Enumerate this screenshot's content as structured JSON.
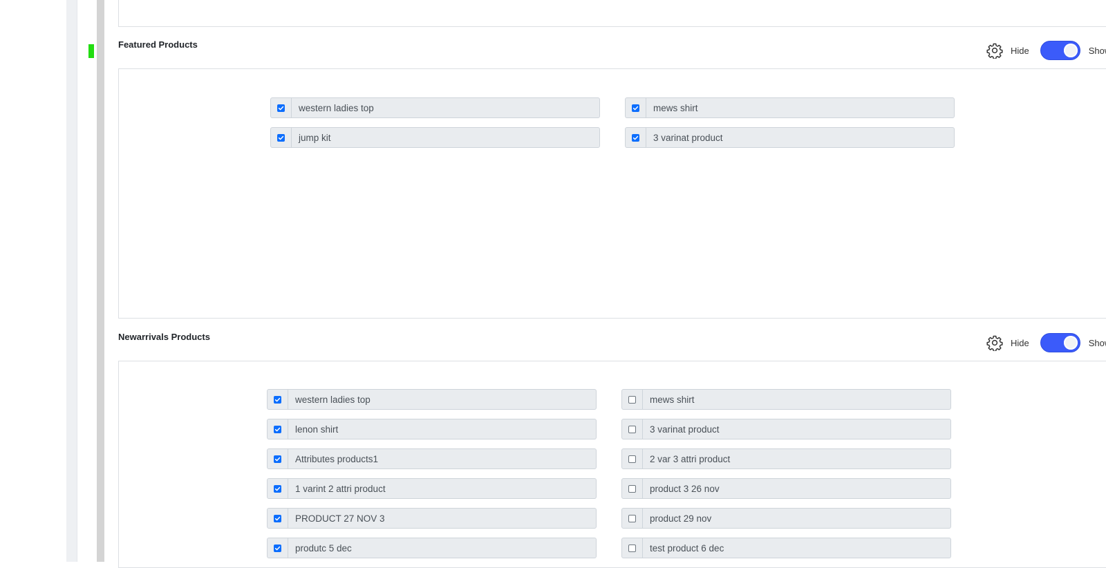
{
  "featured": {
    "title": "Featured Products",
    "hide_label": "Hide",
    "show_label": "Show",
    "toggle_on": true,
    "items": [
      {
        "label": "western ladies top",
        "checked": true
      },
      {
        "label": "mews shirt",
        "checked": true
      },
      {
        "label": "jump kit",
        "checked": true
      },
      {
        "label": "3 varinat product",
        "checked": true
      }
    ]
  },
  "newarrivals": {
    "title": "Newarrivals Products",
    "hide_label": "Hide",
    "show_label": "Show",
    "toggle_on": true,
    "items": [
      {
        "label": "western ladies top",
        "checked": true
      },
      {
        "label": "mews shirt",
        "checked": false
      },
      {
        "label": "lenon shirt",
        "checked": true
      },
      {
        "label": "3 varinat product",
        "checked": false
      },
      {
        "label": "Attributes products1",
        "checked": true
      },
      {
        "label": "2 var 3 attri product",
        "checked": false
      },
      {
        "label": "1 varint 2 attri product",
        "checked": true
      },
      {
        "label": "product 3 26 nov",
        "checked": false
      },
      {
        "label": "PRODUCT 27 NOV 3",
        "checked": true
      },
      {
        "label": "product 29 nov",
        "checked": false
      },
      {
        "label": "produtc 5 dec",
        "checked": true
      },
      {
        "label": "test product 6 dec",
        "checked": false
      }
    ]
  },
  "colors": {
    "toggle": "#3b5bfa",
    "checkbox": "#0d6efd",
    "item_bg": "#e9ecef",
    "indicator": "#22dd11"
  },
  "icons": {
    "gear": "gear-icon",
    "check": "check-icon"
  }
}
